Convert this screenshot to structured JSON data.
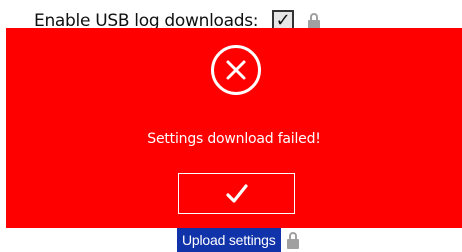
{
  "settings": {
    "usb_log_label": "Enable USB log downloads:",
    "usb_log_checkbox_mark": "✓"
  },
  "dialog": {
    "message": "Settings download failed!",
    "icon": "error-x-icon",
    "confirm_icon": "checkmark-icon",
    "background_color": "#ff0000"
  },
  "actions": {
    "upload_label": "Upload settings",
    "upload_color": "#1033aa"
  }
}
